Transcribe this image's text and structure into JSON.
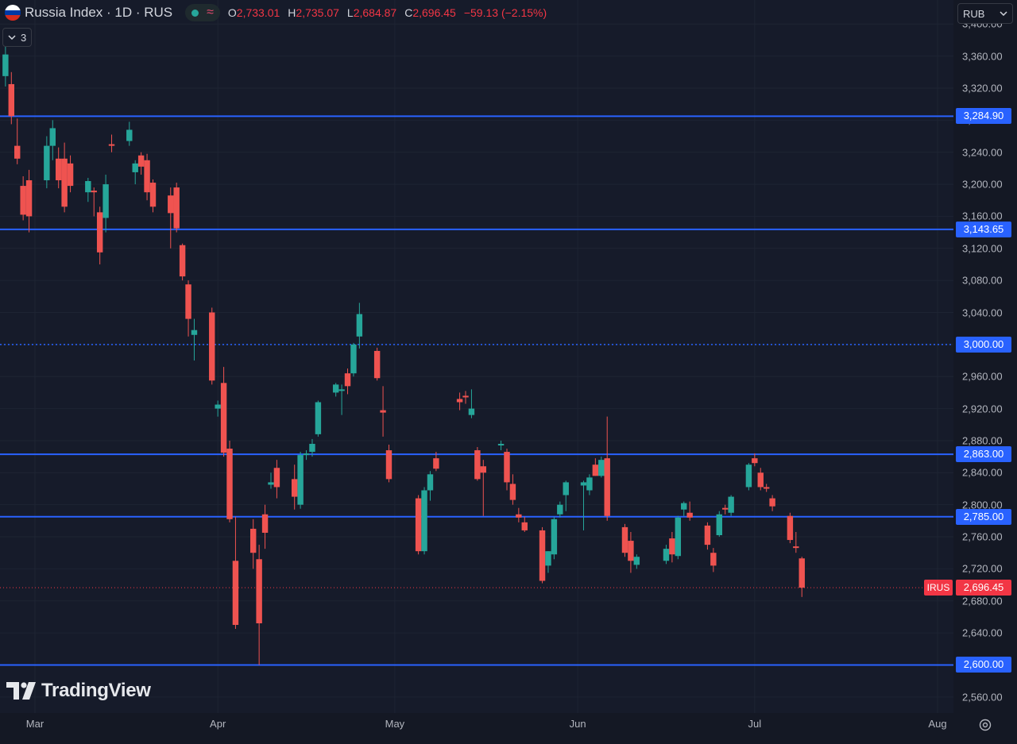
{
  "header": {
    "symbol_title": "Russia Index · 1D · RUS",
    "o_label": "O",
    "o_value": "2,733.01",
    "h_label": "H",
    "h_value": "2,735.07",
    "l_label": "L",
    "l_value": "2,684.87",
    "c_label": "C",
    "c_value": "2,696.45",
    "change": "−59.13 (−2.15%)",
    "flag_colors": [
      "#ffffff",
      "#0039a6",
      "#d52b1e"
    ],
    "status_color": "#26a69a",
    "wave_icon": "wave-icon"
  },
  "indicators_toggle": {
    "count": "3",
    "icon": "chevron-down-icon"
  },
  "currency": {
    "value": "RUB",
    "icon": "chevron-down-icon"
  },
  "brand": {
    "name": "TradingView",
    "icon": "tradingview-logo-icon"
  },
  "symbol_tag": "IRUS",
  "colors": {
    "up": "#26a69a",
    "down": "#ef5350",
    "level": "#2962ff",
    "last": "#f23645"
  },
  "chart_data": {
    "type": "candlestick",
    "ylim": [
      2540,
      3430
    ],
    "y_ticks": [
      2560,
      2600,
      2640,
      2680,
      2720,
      2760,
      2800,
      2840,
      2880,
      2920,
      2960,
      3000,
      3040,
      3080,
      3120,
      3160,
      3200,
      3240,
      3280,
      3320,
      3360,
      3400
    ],
    "y_tick_labels": [
      "2,560.00",
      "2,600.00",
      "2,640.00",
      "2,680.00",
      "2,720.00",
      "2,760.00",
      "2,800.00",
      "2,840.00",
      "2,880.00",
      "2,920.00",
      "2,960.00",
      "3,000.00",
      "3,040.00",
      "3,080.00",
      "3,120.00",
      "3,160.00",
      "3,200.00",
      "3,240.00",
      "3,280.00",
      "3,320.00",
      "3,360.00",
      "3,400.00"
    ],
    "x_ticks": [
      {
        "label": "Mar",
        "date": "2025-03-01"
      },
      {
        "label": "Apr",
        "date": "2025-04-01"
      },
      {
        "label": "May",
        "date": "2025-05-01"
      },
      {
        "label": "Jun",
        "date": "2025-06-01"
      },
      {
        "label": "Jul",
        "date": "2025-07-01"
      },
      {
        "label": "Aug",
        "date": "2025-08-01"
      }
    ],
    "horizontal_levels": [
      {
        "value": 3284.9,
        "label": "3,284.90",
        "style": "solid"
      },
      {
        "value": 3143.65,
        "label": "3,143.65",
        "style": "solid"
      },
      {
        "value": 3000.0,
        "label": "3,000.00",
        "style": "dotted"
      },
      {
        "value": 2863.0,
        "label": "2,863.00",
        "style": "solid"
      },
      {
        "value": 2785.0,
        "label": "2,785.00",
        "style": "solid"
      },
      {
        "value": 2600.0,
        "label": "2,600.00",
        "style": "solid"
      }
    ],
    "last_price": {
      "value": 2696.45,
      "label": "2,696.45"
    },
    "candles": [
      {
        "date": "2025-02-24",
        "o": 3335,
        "h": 3372,
        "l": 3322,
        "c": 3362
      },
      {
        "date": "2025-02-25",
        "o": 3325,
        "h": 3340,
        "l": 3275,
        "c": 3285
      },
      {
        "date": "2025-02-26",
        "o": 3248,
        "h": 3282,
        "l": 3225,
        "c": 3232
      },
      {
        "date": "2025-02-27",
        "o": 3198,
        "h": 3210,
        "l": 3155,
        "c": 3162
      },
      {
        "date": "2025-02-28",
        "o": 3205,
        "h": 3218,
        "l": 3140,
        "c": 3160
      },
      {
        "date": "2025-03-03",
        "o": 3205,
        "h": 3260,
        "l": 3195,
        "c": 3248
      },
      {
        "date": "2025-03-04",
        "o": 3248,
        "h": 3280,
        "l": 3230,
        "c": 3270
      },
      {
        "date": "2025-03-05",
        "o": 3232,
        "h": 3246,
        "l": 3195,
        "c": 3205
      },
      {
        "date": "2025-03-06",
        "o": 3232,
        "h": 3252,
        "l": 3165,
        "c": 3172
      },
      {
        "date": "2025-03-07",
        "o": 3226,
        "h": 3236,
        "l": 3190,
        "c": 3198
      },
      {
        "date": "2025-03-10",
        "o": 3190,
        "h": 3208,
        "l": 3178,
        "c": 3204
      },
      {
        "date": "2025-03-11",
        "o": 3192,
        "h": 3196,
        "l": 3160,
        "c": 3190
      },
      {
        "date": "2025-03-12",
        "o": 3165,
        "h": 3172,
        "l": 3100,
        "c": 3115
      },
      {
        "date": "2025-03-13",
        "o": 3158,
        "h": 3212,
        "l": 3140,
        "c": 3200
      },
      {
        "date": "2025-03-14",
        "o": 3250,
        "h": 3262,
        "l": 3240,
        "c": 3248
      },
      {
        "date": "2025-03-17",
        "o": 3254,
        "h": 3278,
        "l": 3248,
        "c": 3268
      },
      {
        "date": "2025-03-18",
        "o": 3215,
        "h": 3230,
        "l": 3200,
        "c": 3226
      },
      {
        "date": "2025-03-19",
        "o": 3236,
        "h": 3240,
        "l": 3212,
        "c": 3222
      },
      {
        "date": "2025-03-20",
        "o": 3230,
        "h": 3238,
        "l": 3180,
        "c": 3190
      },
      {
        "date": "2025-03-21",
        "o": 3202,
        "h": 3206,
        "l": 3165,
        "c": 3172
      },
      {
        "date": "2025-03-24",
        "o": 3186,
        "h": 3196,
        "l": 3120,
        "c": 3164
      },
      {
        "date": "2025-03-25",
        "o": 3196,
        "h": 3202,
        "l": 3140,
        "c": 3145
      },
      {
        "date": "2025-03-26",
        "o": 3124,
        "h": 3126,
        "l": 3080,
        "c": 3085
      },
      {
        "date": "2025-03-27",
        "o": 3075,
        "h": 3080,
        "l": 3010,
        "c": 3032
      },
      {
        "date": "2025-03-28",
        "o": 3012,
        "h": 3032,
        "l": 2980,
        "c": 3018
      },
      {
        "date": "2025-03-31",
        "o": 3040,
        "h": 3046,
        "l": 2950,
        "c": 2955
      },
      {
        "date": "2025-04-01",
        "o": 2920,
        "h": 2930,
        "l": 2910,
        "c": 2925
      },
      {
        "date": "2025-04-02",
        "o": 2952,
        "h": 2972,
        "l": 2860,
        "c": 2865
      },
      {
        "date": "2025-04-03",
        "o": 2870,
        "h": 2880,
        "l": 2778,
        "c": 2782
      },
      {
        "date": "2025-04-04",
        "o": 2730,
        "h": 2785,
        "l": 2645,
        "c": 2650
      },
      {
        "date": "2025-04-07",
        "o": 2770,
        "h": 2782,
        "l": 2720,
        "c": 2740
      },
      {
        "date": "2025-04-08",
        "o": 2732,
        "h": 2750,
        "l": 2600,
        "c": 2652
      },
      {
        "date": "2025-04-09",
        "o": 2788,
        "h": 2800,
        "l": 2745,
        "c": 2765
      },
      {
        "date": "2025-04-10",
        "o": 2825,
        "h": 2840,
        "l": 2820,
        "c": 2828
      },
      {
        "date": "2025-04-11",
        "o": 2846,
        "h": 2856,
        "l": 2808,
        "c": 2822
      },
      {
        "date": "2025-04-14",
        "o": 2832,
        "h": 2850,
        "l": 2794,
        "c": 2810
      },
      {
        "date": "2025-04-15",
        "o": 2800,
        "h": 2866,
        "l": 2795,
        "c": 2862
      },
      {
        "date": "2025-04-16",
        "o": 2862,
        "h": 2868,
        "l": 2856,
        "c": 2864
      },
      {
        "date": "2025-04-17",
        "o": 2866,
        "h": 2882,
        "l": 2860,
        "c": 2876
      },
      {
        "date": "2025-04-18",
        "o": 2888,
        "h": 2930,
        "l": 2885,
        "c": 2928
      },
      {
        "date": "2025-04-21",
        "o": 2940,
        "h": 2952,
        "l": 2935,
        "c": 2950
      },
      {
        "date": "2025-04-22",
        "o": 2942,
        "h": 2950,
        "l": 2912,
        "c": 2944
      },
      {
        "date": "2025-04-23",
        "o": 2964,
        "h": 2970,
        "l": 2938,
        "c": 2948
      },
      {
        "date": "2025-04-24",
        "o": 2964,
        "h": 3002,
        "l": 2960,
        "c": 3000
      },
      {
        "date": "2025-04-25",
        "o": 3010,
        "h": 3052,
        "l": 2995,
        "c": 3038
      },
      {
        "date": "2025-04-28",
        "o": 2992,
        "h": 2996,
        "l": 2955,
        "c": 2958
      },
      {
        "date": "2025-04-29",
        "o": 2918,
        "h": 2948,
        "l": 2885,
        "c": 2915
      },
      {
        "date": "2025-04-30",
        "o": 2868,
        "h": 2875,
        "l": 2828,
        "c": 2832
      },
      {
        "date": "2025-05-05",
        "o": 2808,
        "h": 2812,
        "l": 2738,
        "c": 2742
      },
      {
        "date": "2025-05-06",
        "o": 2742,
        "h": 2822,
        "l": 2738,
        "c": 2818
      },
      {
        "date": "2025-05-07",
        "o": 2818,
        "h": 2842,
        "l": 2805,
        "c": 2838
      },
      {
        "date": "2025-05-08",
        "o": 2858,
        "h": 2866,
        "l": 2842,
        "c": 2845
      },
      {
        "date": "2025-05-12",
        "o": 2932,
        "h": 2940,
        "l": 2918,
        "c": 2928
      },
      {
        "date": "2025-05-13",
        "o": 2936,
        "h": 2942,
        "l": 2926,
        "c": 2934
      },
      {
        "date": "2025-05-14",
        "o": 2912,
        "h": 2944,
        "l": 2908,
        "c": 2920
      },
      {
        "date": "2025-05-15",
        "o": 2868,
        "h": 2872,
        "l": 2830,
        "c": 2832
      },
      {
        "date": "2025-05-16",
        "o": 2848,
        "h": 2856,
        "l": 2786,
        "c": 2840
      },
      {
        "date": "2025-05-19",
        "o": 2874,
        "h": 2880,
        "l": 2868,
        "c": 2876
      },
      {
        "date": "2025-05-20",
        "o": 2866,
        "h": 2870,
        "l": 2818,
        "c": 2828
      },
      {
        "date": "2025-05-21",
        "o": 2826,
        "h": 2838,
        "l": 2800,
        "c": 2806
      },
      {
        "date": "2025-05-22",
        "o": 2788,
        "h": 2796,
        "l": 2778,
        "c": 2784
      },
      {
        "date": "2025-05-23",
        "o": 2778,
        "h": 2785,
        "l": 2766,
        "c": 2768
      },
      {
        "date": "2025-05-26",
        "o": 2768,
        "h": 2772,
        "l": 2702,
        "c": 2705
      },
      {
        "date": "2025-05-27",
        "o": 2724,
        "h": 2742,
        "l": 2715,
        "c": 2742
      },
      {
        "date": "2025-05-28",
        "o": 2738,
        "h": 2785,
        "l": 2732,
        "c": 2782
      },
      {
        "date": "2025-05-29",
        "o": 2788,
        "h": 2804,
        "l": 2784,
        "c": 2800
      },
      {
        "date": "2025-05-30",
        "o": 2812,
        "h": 2830,
        "l": 2792,
        "c": 2828
      },
      {
        "date": "2025-06-02",
        "o": 2824,
        "h": 2830,
        "l": 2768,
        "c": 2828
      },
      {
        "date": "2025-06-03",
        "o": 2818,
        "h": 2838,
        "l": 2812,
        "c": 2834
      },
      {
        "date": "2025-06-04",
        "o": 2850,
        "h": 2858,
        "l": 2836,
        "c": 2836
      },
      {
        "date": "2025-06-05",
        "o": 2836,
        "h": 2860,
        "l": 2834,
        "c": 2856
      },
      {
        "date": "2025-06-06",
        "o": 2858,
        "h": 2910,
        "l": 2780,
        "c": 2786
      },
      {
        "date": "2025-06-09",
        "o": 2772,
        "h": 2776,
        "l": 2735,
        "c": 2740
      },
      {
        "date": "2025-06-10",
        "o": 2755,
        "h": 2766,
        "l": 2715,
        "c": 2730
      },
      {
        "date": "2025-06-11",
        "o": 2725,
        "h": 2738,
        "l": 2720,
        "c": 2735
      },
      {
        "date": "2025-06-16",
        "o": 2730,
        "h": 2750,
        "l": 2726,
        "c": 2745
      },
      {
        "date": "2025-06-17",
        "o": 2758,
        "h": 2766,
        "l": 2728,
        "c": 2738
      },
      {
        "date": "2025-06-18",
        "o": 2736,
        "h": 2786,
        "l": 2732,
        "c": 2784
      },
      {
        "date": "2025-06-19",
        "o": 2794,
        "h": 2804,
        "l": 2786,
        "c": 2802
      },
      {
        "date": "2025-06-20",
        "o": 2790,
        "h": 2804,
        "l": 2780,
        "c": 2784
      },
      {
        "date": "2025-06-23",
        "o": 2774,
        "h": 2778,
        "l": 2744,
        "c": 2750
      },
      {
        "date": "2025-06-24",
        "o": 2740,
        "h": 2746,
        "l": 2716,
        "c": 2724
      },
      {
        "date": "2025-06-25",
        "o": 2762,
        "h": 2792,
        "l": 2760,
        "c": 2788
      },
      {
        "date": "2025-06-26",
        "o": 2796,
        "h": 2800,
        "l": 2788,
        "c": 2794
      },
      {
        "date": "2025-06-27",
        "o": 2790,
        "h": 2812,
        "l": 2786,
        "c": 2810
      },
      {
        "date": "2025-06-30",
        "o": 2822,
        "h": 2852,
        "l": 2818,
        "c": 2850
      },
      {
        "date": "2025-07-01",
        "o": 2858,
        "h": 2864,
        "l": 2848,
        "c": 2852
      },
      {
        "date": "2025-07-02",
        "o": 2840,
        "h": 2846,
        "l": 2818,
        "c": 2822
      },
      {
        "date": "2025-07-03",
        "o": 2822,
        "h": 2826,
        "l": 2816,
        "c": 2820
      },
      {
        "date": "2025-07-04",
        "o": 2808,
        "h": 2812,
        "l": 2792,
        "c": 2798
      },
      {
        "date": "2025-07-07",
        "o": 2786,
        "h": 2790,
        "l": 2752,
        "c": 2756
      },
      {
        "date": "2025-07-08",
        "o": 2748,
        "h": 2766,
        "l": 2740,
        "c": 2746
      },
      {
        "date": "2025-07-09",
        "o": 2733.01,
        "h": 2735.07,
        "l": 2684.87,
        "c": 2696.45
      }
    ]
  }
}
